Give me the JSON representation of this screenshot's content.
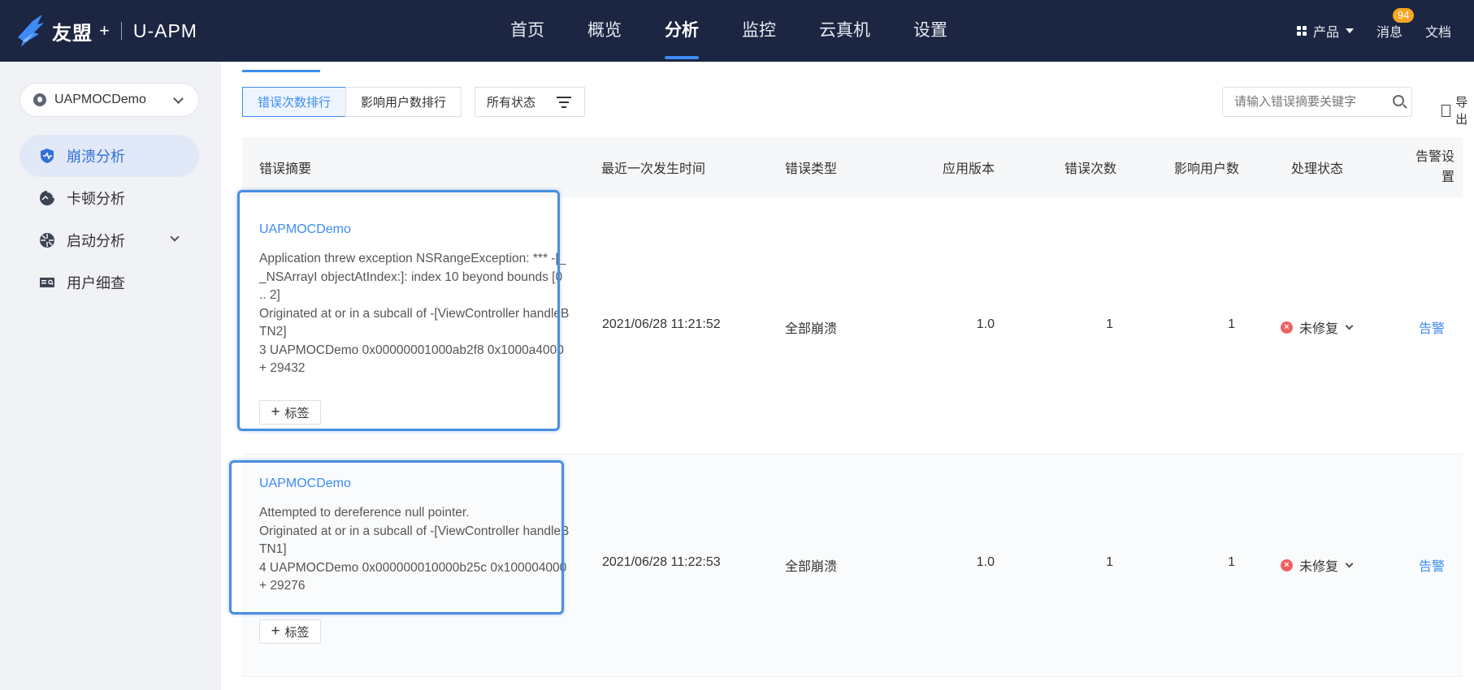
{
  "header": {
    "brand": "友盟",
    "plus": "+",
    "product": "U-APM",
    "nav": [
      "首页",
      "概览",
      "分析",
      "监控",
      "云真机",
      "设置"
    ],
    "active_nav": "分析",
    "products_label": "产品",
    "messages_label": "消息",
    "messages_count": "94",
    "docs_label": "文档"
  },
  "sidebar": {
    "app_name": "UAPMOCDemo",
    "items": [
      {
        "label": "崩溃分析",
        "icon": "shield-icon",
        "active": true
      },
      {
        "label": "卡顿分析",
        "icon": "pie-chart-icon",
        "active": false
      },
      {
        "label": "启动分析",
        "icon": "aperture-icon",
        "active": false
      },
      {
        "label": "用户细查",
        "icon": "id-card-icon",
        "active": false
      }
    ]
  },
  "toolbar": {
    "sort_by_errors": "错误次数排行",
    "sort_by_users": "影响用户数排行",
    "status_filter": "所有状态",
    "search_placeholder": "请输入错误摘要关键字",
    "export_label": "导出"
  },
  "table": {
    "headers": [
      "错误摘要",
      "最近一次发生时间",
      "错误类型",
      "应用版本",
      "错误次数",
      "影响用户数",
      "处理状态",
      "告警设置"
    ],
    "alarm_header_line1": "告警设",
    "alarm_header_line2": "置",
    "tag_label": "标签",
    "rows": [
      {
        "app": "UAPMOCDemo",
        "summary_lines": [
          "Application threw exception NSRangeException: *** -[__NSArrayI objectAtIndex:]: index 10 beyond bounds [0 .. 2]",
          "Originated at or in a subcall of -[ViewController handleBTN2]",
          "3 UAPMOCDemo 0x00000001000ab2f8 0x1000a4000 + 29432"
        ],
        "time": "2021/06/28 11:21:52",
        "type": "全部崩溃",
        "version": "1.0",
        "errors": "1",
        "users": "1",
        "status": "未修复",
        "alarm": "告警"
      },
      {
        "app": "UAPMOCDemo",
        "summary_lines": [
          "Attempted to dereference null pointer.",
          "Originated at or in a subcall of -[ViewController handleBTN1]",
          "4 UAPMOCDemo 0x000000010000b25c 0x100004000 + 29276"
        ],
        "time": "2021/06/28 11:22:53",
        "type": "全部崩溃",
        "version": "1.0",
        "errors": "1",
        "users": "1",
        "status": "未修复",
        "alarm": "告警"
      }
    ]
  },
  "colors": {
    "topbar": "#1c2541",
    "accent": "#3e8bf5",
    "error": "#f06060",
    "badge": "#f5a623"
  }
}
